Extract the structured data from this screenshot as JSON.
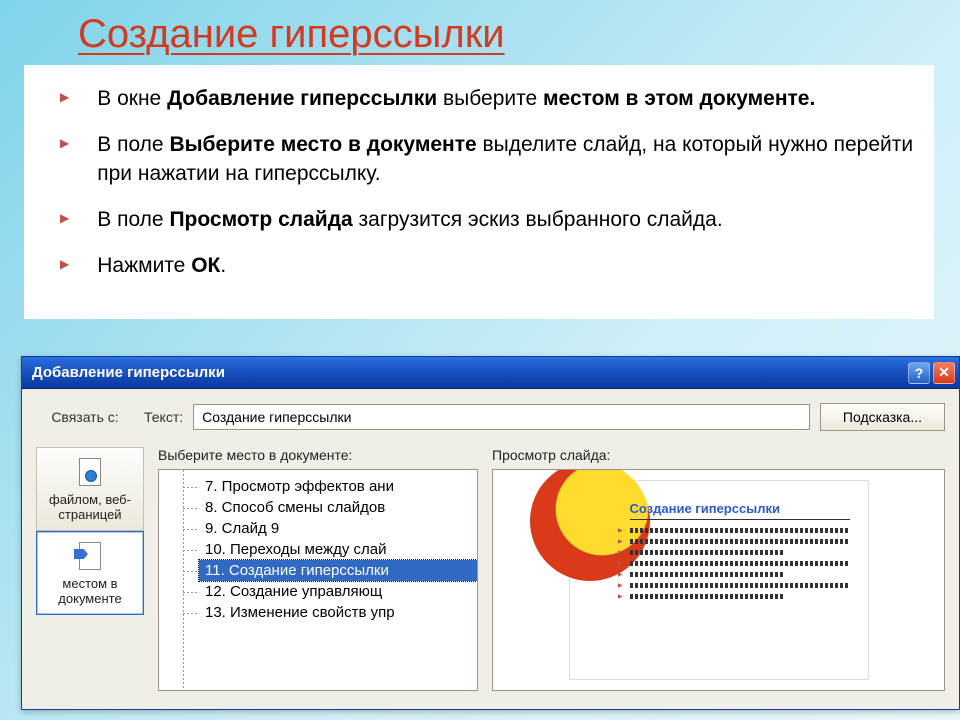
{
  "slide": {
    "title": "Создание гиперссылки",
    "bullets": [
      {
        "pre": "В окне ",
        "bold": "Добавление гиперссылки",
        "mid": " выберите ",
        "bold2": "местом в этом документе.",
        "post": ""
      },
      {
        "pre": "В поле ",
        "bold": "Выберите место в документе",
        "mid": " выделите слайд, на который нужно перейти при нажатии на гиперссылку.",
        "bold2": "",
        "post": ""
      },
      {
        "pre": "В поле ",
        "bold": "Просмотр слайда",
        "mid": " загрузится эскиз выбранного слайда.",
        "bold2": "",
        "post": ""
      },
      {
        "pre": "Нажмите ",
        "bold": "ОК",
        "mid": ".",
        "bold2": "",
        "post": ""
      }
    ]
  },
  "dialog": {
    "title": "Добавление гиперссылки",
    "helpGlyph": "?",
    "closeGlyph": "✕",
    "linkLabel": "Связать с:",
    "textLabel": "Текст:",
    "textValue": "Создание гиперссылки",
    "hintButton": "Подсказка...",
    "sidebar": [
      {
        "name": "file-web",
        "label": "файлом, веб-страницей",
        "active": false
      },
      {
        "name": "place-in-doc",
        "label": "местом в документе",
        "active": true
      }
    ],
    "treeLabel": "Выберите место в документе:",
    "tree": [
      "7. Просмотр эффектов ани",
      "8. Способ смены слайдов",
      "9. Слайд 9",
      "10. Переходы между слай",
      "11. Создание гиперссылки",
      "12. Создание управляющ",
      "13. Изменение свойств упр"
    ],
    "treeSelectedIndex": 4,
    "previewLabel": "Просмотр слайда:",
    "previewTitle": "Создание гиперссылки"
  }
}
